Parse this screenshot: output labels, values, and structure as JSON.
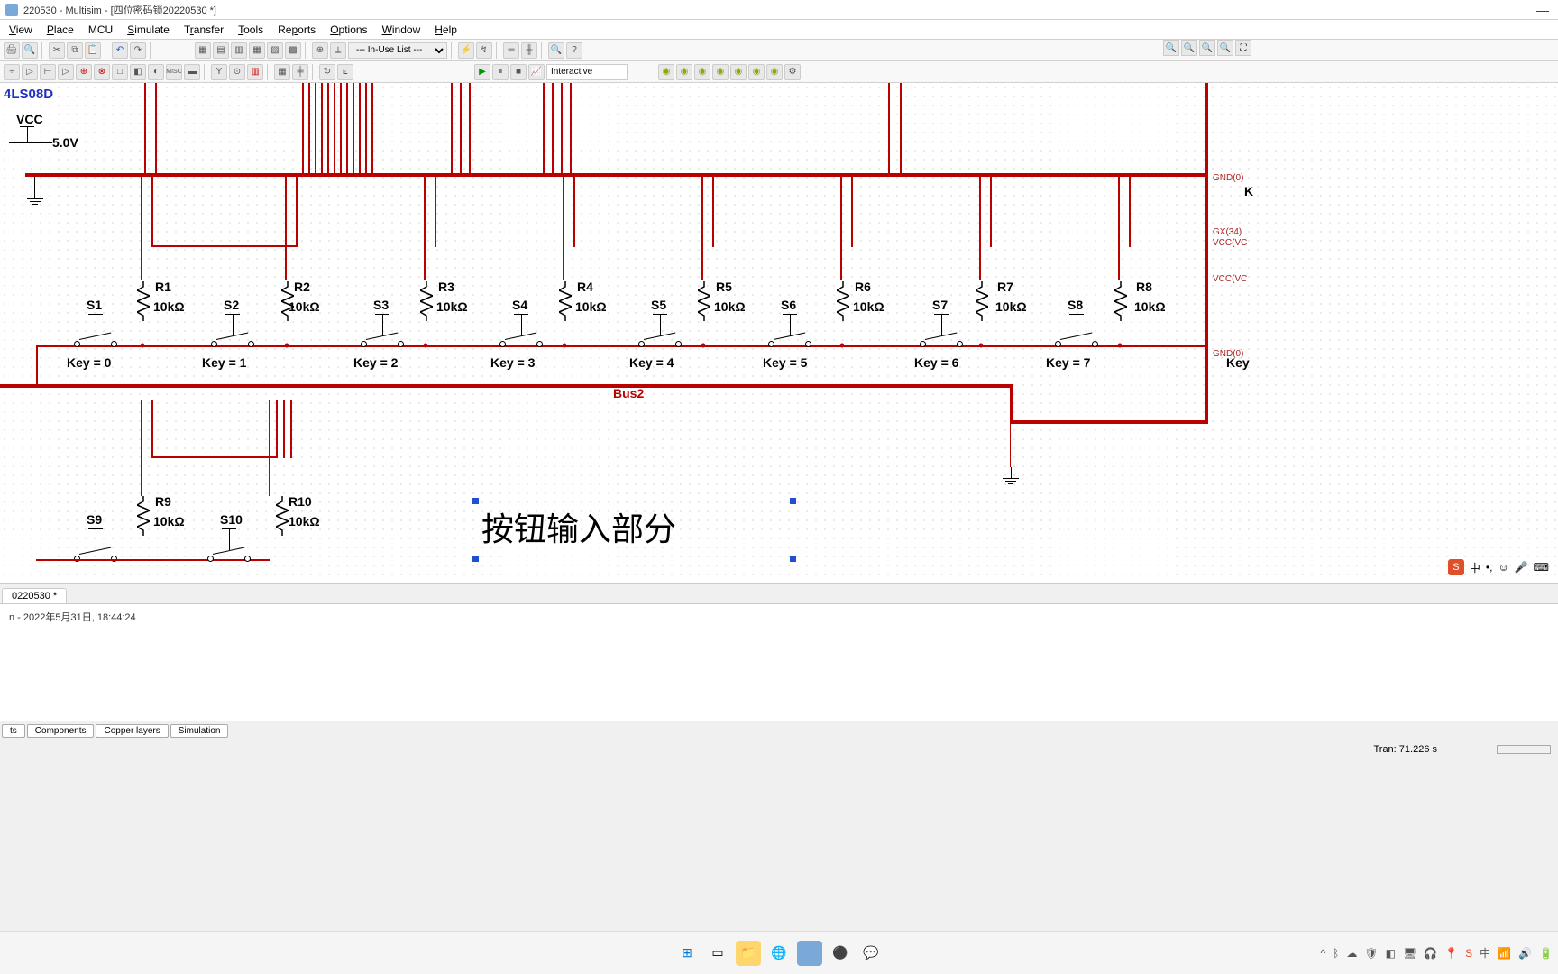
{
  "title": "220530 - Multisim - [四位密码锁20220530 *]",
  "menu": {
    "view": "View",
    "place": "Place",
    "mcu": "MCU",
    "simulate": "Simulate",
    "transfer": "Transfer",
    "tools": "Tools",
    "reports": "Reports",
    "options": "Options",
    "window": "Window",
    "help": "Help"
  },
  "toolbar": {
    "inuse": "--- In-Use List ---",
    "interactive": "Interactive"
  },
  "schematic": {
    "ic": "4LS08D",
    "vcc": "VCC",
    "vcc_val": "5.0V",
    "bus2": "Bus2",
    "annotation": "按钮输入部分",
    "resistors": [
      {
        "name": "R1",
        "val": "10kΩ"
      },
      {
        "name": "R2",
        "val": "10kΩ"
      },
      {
        "name": "R3",
        "val": "10kΩ"
      },
      {
        "name": "R4",
        "val": "10kΩ"
      },
      {
        "name": "R5",
        "val": "10kΩ"
      },
      {
        "name": "R6",
        "val": "10kΩ"
      },
      {
        "name": "R7",
        "val": "10kΩ"
      },
      {
        "name": "R8",
        "val": "10kΩ"
      },
      {
        "name": "R9",
        "val": "10kΩ"
      },
      {
        "name": "R10",
        "val": "10kΩ"
      }
    ],
    "switches": [
      {
        "name": "S1",
        "key": "Key = 0"
      },
      {
        "name": "S2",
        "key": "Key = 1"
      },
      {
        "name": "S3",
        "key": "Key = 2"
      },
      {
        "name": "S4",
        "key": "Key = 3"
      },
      {
        "name": "S5",
        "key": "Key = 4"
      },
      {
        "name": "S6",
        "key": "Key = 5"
      },
      {
        "name": "S7",
        "key": "Key = 6"
      },
      {
        "name": "S8",
        "key": "Key = 7"
      },
      {
        "name": "S9",
        "key": ""
      },
      {
        "name": "S10",
        "key": ""
      }
    ],
    "rlabels": {
      "gnd0": "GND(0)",
      "k": "K",
      "gx34": "GX(34)",
      "vccvc": "VCC(VC",
      "vccvc2": "VCC(VC",
      "gnd02": "GND(0)",
      "key": "Key"
    }
  },
  "tabs": {
    "file": "0220530 *"
  },
  "log": {
    "line1": "n  -  2022年5月31日, 18:44:24"
  },
  "bottom_tabs": {
    "t1": "ts",
    "t2": "Components",
    "t3": "Copper layers",
    "t4": "Simulation"
  },
  "status": {
    "tran": "Tran: 71.226 s"
  },
  "ime": {
    "lang": "中"
  }
}
